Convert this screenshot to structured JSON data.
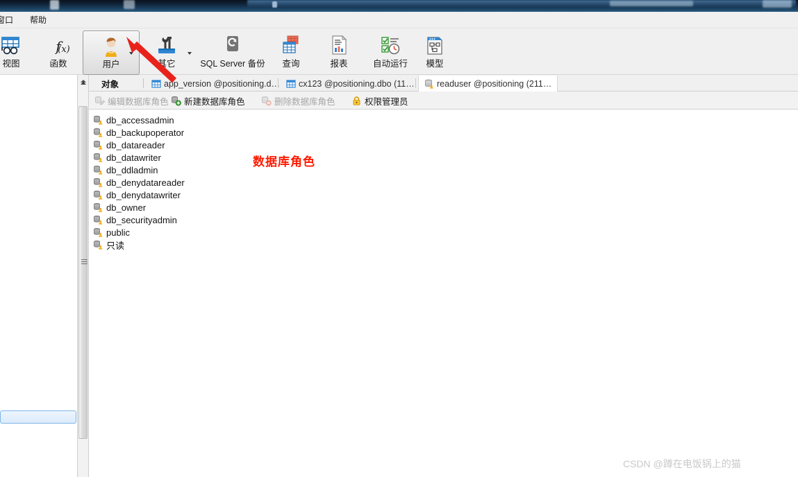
{
  "window": {
    "titlebar_color": "#102438",
    "menu": [
      {
        "label": "窗口",
        "name": "menu-window"
      },
      {
        "label": "帮助",
        "name": "menu-help"
      }
    ]
  },
  "ribbon": {
    "buttons": [
      {
        "label": "视图",
        "icon": "view-table-icon",
        "active": false,
        "dropdown": false
      },
      {
        "label": "函数",
        "icon": "function-fx-icon",
        "active": false,
        "dropdown": false
      },
      {
        "label": "用户",
        "icon": "user-person-icon",
        "active": true,
        "dropdown": true
      },
      {
        "label": "其它",
        "icon": "tools-wrench-icon",
        "active": false,
        "dropdown": true
      },
      {
        "label": "SQL Server 备份",
        "icon": "backup-restore-icon",
        "active": false,
        "dropdown": false
      },
      {
        "label": "查询",
        "icon": "query-grid-icon",
        "active": false,
        "dropdown": false
      },
      {
        "label": "报表",
        "icon": "report-document-icon",
        "active": false,
        "dropdown": false
      },
      {
        "label": "自动运行",
        "icon": "schedule-clock-icon",
        "active": false,
        "dropdown": false
      },
      {
        "label": "模型",
        "icon": "model-diagram-icon",
        "active": false,
        "dropdown": false
      }
    ]
  },
  "tabs": {
    "object_tab": "对象",
    "items": [
      {
        "label": "app_version @positioning.d…",
        "icon": "table-icon",
        "active": false
      },
      {
        "label": "cx123 @positioning.dbo (11…",
        "icon": "table-icon",
        "active": false
      },
      {
        "label": "readuser @positioning (211…",
        "icon": "database-user-icon",
        "active": true
      }
    ]
  },
  "role_toolbar": {
    "items": [
      {
        "label": "编辑数据库角色",
        "icon": "edit-role-icon",
        "enabled": false
      },
      {
        "label": "新建数据库角色",
        "icon": "new-role-icon",
        "enabled": true
      },
      {
        "label": "删除数据库角色",
        "icon": "delete-role-icon",
        "enabled": false
      },
      {
        "label": "权限管理员",
        "icon": "lock-icon",
        "enabled": true
      }
    ]
  },
  "role_list": {
    "items": [
      {
        "label": "db_accessadmin",
        "icon": "db-role-icon"
      },
      {
        "label": "db_backupoperator",
        "icon": "db-role-icon"
      },
      {
        "label": "db_datareader",
        "icon": "db-role-icon"
      },
      {
        "label": "db_datawriter",
        "icon": "db-role-icon"
      },
      {
        "label": "db_ddladmin",
        "icon": "db-role-icon"
      },
      {
        "label": "db_denydatareader",
        "icon": "db-role-icon"
      },
      {
        "label": "db_denydatawriter",
        "icon": "db-role-icon"
      },
      {
        "label": "db_owner",
        "icon": "db-role-icon"
      },
      {
        "label": "db_securityadmin",
        "icon": "db-role-icon"
      },
      {
        "label": "public",
        "icon": "db-role-icon"
      },
      {
        "label": "只读",
        "icon": "db-role-icon"
      }
    ]
  },
  "annotations": {
    "red_label": "数据库角色",
    "red_color": "#ff1a00",
    "arrow": {
      "name": "red-arrow-pointer",
      "color": "#e8221a"
    }
  },
  "watermark": {
    "text": "CSDN @蹲在电饭锅上的猫",
    "color": "#c9c9c9"
  }
}
